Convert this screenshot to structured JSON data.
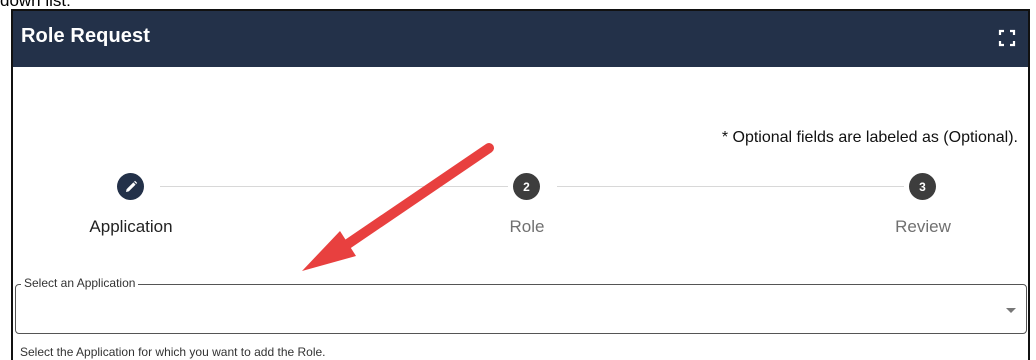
{
  "caption": "down list:",
  "header": {
    "title": "Role Request"
  },
  "optional_note": "* Optional fields are labeled as (Optional).",
  "stepper": {
    "steps": [
      {
        "number": "",
        "label": "Application",
        "state": "active"
      },
      {
        "number": "2",
        "label": "Role",
        "state": "pending"
      },
      {
        "number": "3",
        "label": "Review",
        "state": "pending"
      }
    ]
  },
  "application_select": {
    "label": "Select an Application",
    "value": "",
    "helper": "Select the Application for which you want to add the Role."
  },
  "colors": {
    "header_bg": "#233149",
    "active_step": "#233149",
    "pending_step": "#3d3d3d",
    "annotation_arrow": "#e8403f"
  },
  "icons": {
    "expand": "fullscreen-expand-icon",
    "active_step": "pencil-icon",
    "dropdown": "caret-down-icon",
    "annotation": "red-arrow-annotation"
  }
}
